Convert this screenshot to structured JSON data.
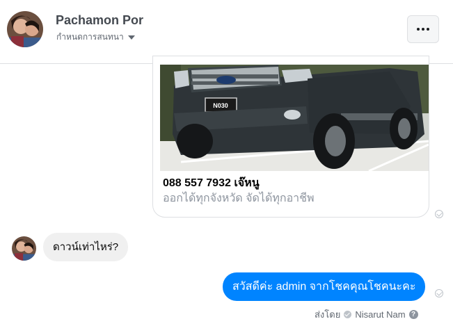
{
  "header": {
    "name": "Pachamon Por",
    "subtitle": "กำหนดการสนทนา",
    "more_label": "More options"
  },
  "card": {
    "image_alt": "Dark grey pickup truck with license plate",
    "plate": "N030",
    "title": "088 557 7932 เจ๊หนู",
    "description": "ออกได้ทุกจังหวัด จัดได้ทุกอาชีพ"
  },
  "messages": [
    {
      "direction": "in",
      "text": "ดาวน์เท่าไหร่?"
    },
    {
      "direction": "out",
      "text": "สวัสดีค่ะ admin จากโชคคุณโชคนะคะ"
    }
  ],
  "sent_by": {
    "label": "ส่งโดย",
    "name": "Nisarut Nam"
  },
  "colors": {
    "outgoing_bubble": "#0084ff",
    "incoming_bubble": "#f0f0f0",
    "border": "#dddfe2"
  }
}
